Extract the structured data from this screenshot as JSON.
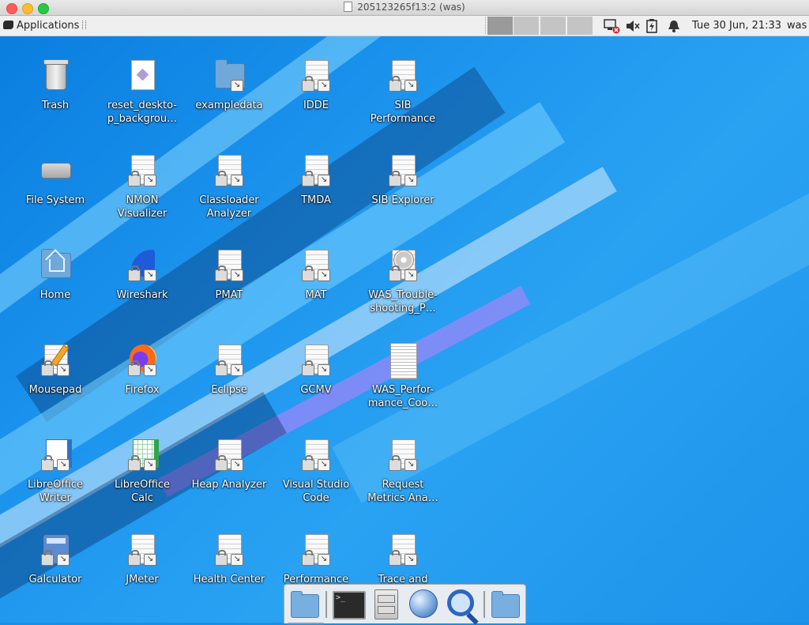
{
  "window": {
    "title": "205123265f13:2 (was)"
  },
  "panel": {
    "applications_label": "Applications",
    "clock": "Tue 30 Jun, 21:33",
    "user": "was"
  },
  "desktop": {
    "icons": [
      {
        "label": "Trash",
        "icon": "trash-icon"
      },
      {
        "label": "reset_deskto-p_backgrou…",
        "icon": "desktop-file-icon"
      },
      {
        "label": "exampledata",
        "icon": "folder-link-icon"
      },
      {
        "label": "IDDE",
        "icon": "launcher-icon"
      },
      {
        "label": "SIB Performance",
        "icon": "launcher-icon"
      },
      {
        "label": "File System",
        "icon": "drive-icon"
      },
      {
        "label": "NMON Visualizer",
        "icon": "launcher-icon"
      },
      {
        "label": "Classloader Analyzer",
        "icon": "launcher-icon"
      },
      {
        "label": "TMDA",
        "icon": "launcher-icon"
      },
      {
        "label": "SIB Explorer",
        "icon": "launcher-icon"
      },
      {
        "label": "Home",
        "icon": "home-folder-icon"
      },
      {
        "label": "Wireshark",
        "icon": "wireshark-icon"
      },
      {
        "label": "PMAT",
        "icon": "launcher-icon"
      },
      {
        "label": "MAT",
        "icon": "launcher-icon"
      },
      {
        "label": "WAS_Trouble-shooting_P…",
        "icon": "cd-launcher-icon"
      },
      {
        "label": "Mousepad",
        "icon": "mousepad-icon"
      },
      {
        "label": "Firefox",
        "icon": "firefox-icon"
      },
      {
        "label": "Eclipse",
        "icon": "launcher-icon"
      },
      {
        "label": "GCMV",
        "icon": "launcher-icon"
      },
      {
        "label": "WAS_Perfor-mance_Coo…",
        "icon": "pdf-document-icon"
      },
      {
        "label": "LibreOffice Writer",
        "icon": "libreoffice-writer-icon"
      },
      {
        "label": "LibreOffice Calc",
        "icon": "libreoffice-calc-icon"
      },
      {
        "label": "Heap Analyzer",
        "icon": "launcher-icon"
      },
      {
        "label": "Visual Studio Code",
        "icon": "launcher-icon"
      },
      {
        "label": "Request Metrics Ana…",
        "icon": "launcher-icon"
      },
      {
        "label": "Galculator",
        "icon": "calculator-icon"
      },
      {
        "label": "JMeter",
        "icon": "launcher-icon"
      },
      {
        "label": "Health Center",
        "icon": "launcher-icon"
      },
      {
        "label": "Performance T…",
        "icon": "launcher-icon"
      },
      {
        "label": "Trace and",
        "icon": "launcher-icon"
      }
    ]
  },
  "dock": {
    "items": [
      {
        "name": "home-folder-icon"
      },
      {
        "name": "terminal-icon"
      },
      {
        "name": "file-cabinet-icon"
      },
      {
        "name": "web-browser-icon"
      },
      {
        "name": "search-icon"
      },
      {
        "name": "folder-icon"
      }
    ]
  },
  "colors": {
    "desktop_blue": "#1b8ee6",
    "panel_bg": "#efefef",
    "close": "#fc5f57",
    "minimize": "#fdbc2e",
    "maximize": "#28c840"
  }
}
